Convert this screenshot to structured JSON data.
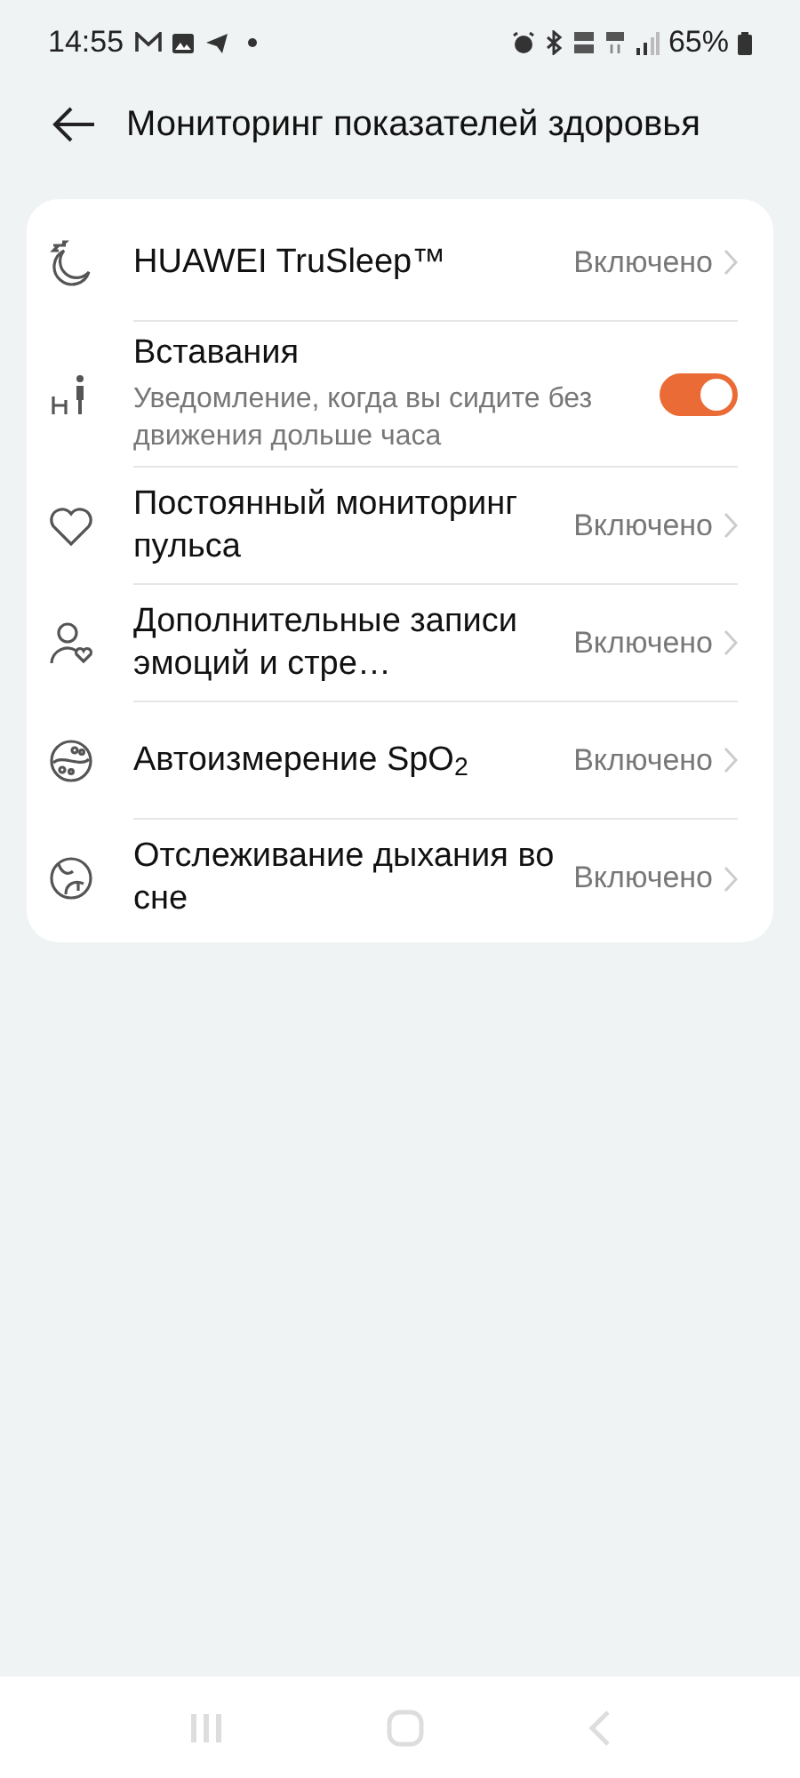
{
  "status_bar": {
    "time": "14:55",
    "battery": "65%"
  },
  "header": {
    "title": "Мониторинг показателей здоровья"
  },
  "items": [
    {
      "kind": "link",
      "label": "HUAWEI TruSleep™",
      "value": "Включено"
    },
    {
      "kind": "toggle",
      "label": "Вставания",
      "subtitle": "Уведомление, когда вы сидите без движения дольше часа",
      "on": true
    },
    {
      "kind": "link",
      "label": "Постоянный мониторинг пульса",
      "value": "Включено"
    },
    {
      "kind": "link",
      "label": "Дополнительные записи эмоций и стре…",
      "value": "Включено"
    },
    {
      "kind": "link",
      "label": "Автоизмерение SpO$_{2}$",
      "value": "Включено"
    },
    {
      "kind": "link",
      "label": "Отслеживание дыхания во сне",
      "value": "Включено"
    }
  ]
}
